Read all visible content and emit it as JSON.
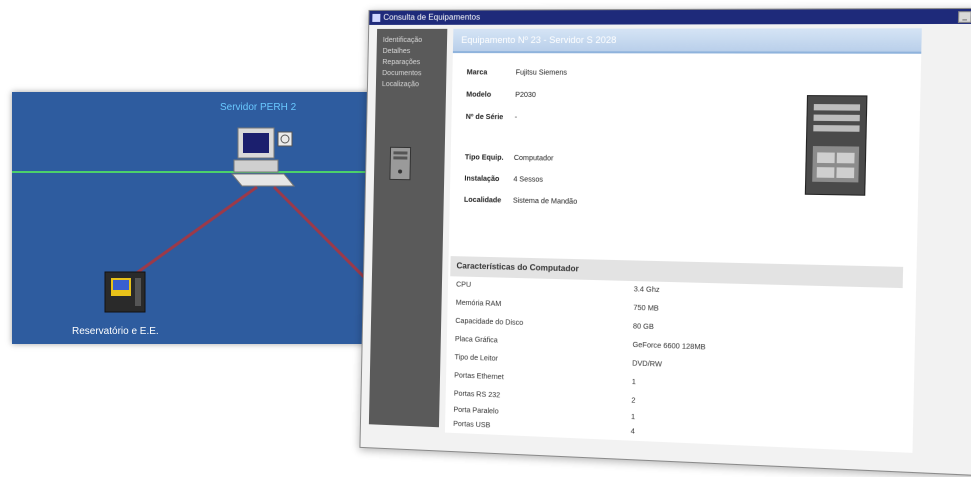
{
  "diagram": {
    "server_label": "Servidor PERH 2",
    "node_label": "Reservatório e E.E."
  },
  "window": {
    "title": "Consulta de Equipamentos",
    "controls": [
      "_",
      "□",
      "X"
    ]
  },
  "sidebar": {
    "items": [
      {
        "label": "Identificação"
      },
      {
        "label": "Detalhes"
      },
      {
        "label": "Reparações"
      },
      {
        "label": "Documentos"
      },
      {
        "label": "Localização"
      }
    ]
  },
  "content": {
    "header": "Equipamento Nº 23 - Servidor S 2028",
    "fields": {
      "marca": {
        "label": "Marca",
        "value": "Fujitsu Siemens"
      },
      "modelo": {
        "label": "Modelo",
        "value": "P2030"
      },
      "serie": {
        "label": "Nº de Série",
        "value": "-"
      },
      "tipo": {
        "label": "Tipo Equip.",
        "value": "Computador"
      },
      "instalacao": {
        "label": "Instalação",
        "value": "4 Sessos"
      },
      "localidade": {
        "label": "Localidade",
        "value": "Sistema de Mandão"
      }
    },
    "section_title": "Características do Computador",
    "characteristics": [
      {
        "name": "CPU",
        "value": "3.4 Ghz"
      },
      {
        "name": "Memória RAM",
        "value": "750 MB"
      },
      {
        "name": "Capacidade do Disco",
        "value": "80 GB"
      },
      {
        "name": "Placa Gráfica",
        "value": "GeForce 6600 128MB"
      },
      {
        "name": "Tipo de Leitor",
        "value": "DVD/RW"
      },
      {
        "name": "Portas Ethernet",
        "value": "1"
      },
      {
        "name": "Portas RS 232",
        "value": "2"
      },
      {
        "name": "Porta Paralelo",
        "value": "1"
      },
      {
        "name": "Portas USB",
        "value": "4"
      }
    ]
  },
  "colors": {
    "diagram_bg": "#2e5c9f",
    "link_red": "#9b3a4a",
    "link_green": "#4cd06a",
    "titlebar": "#1e2a7a",
    "sidebar": "#5a5a5a"
  },
  "icons": {
    "server": "computer-icon",
    "node": "cabinet-icon",
    "tower": "tower-pc-icon"
  }
}
